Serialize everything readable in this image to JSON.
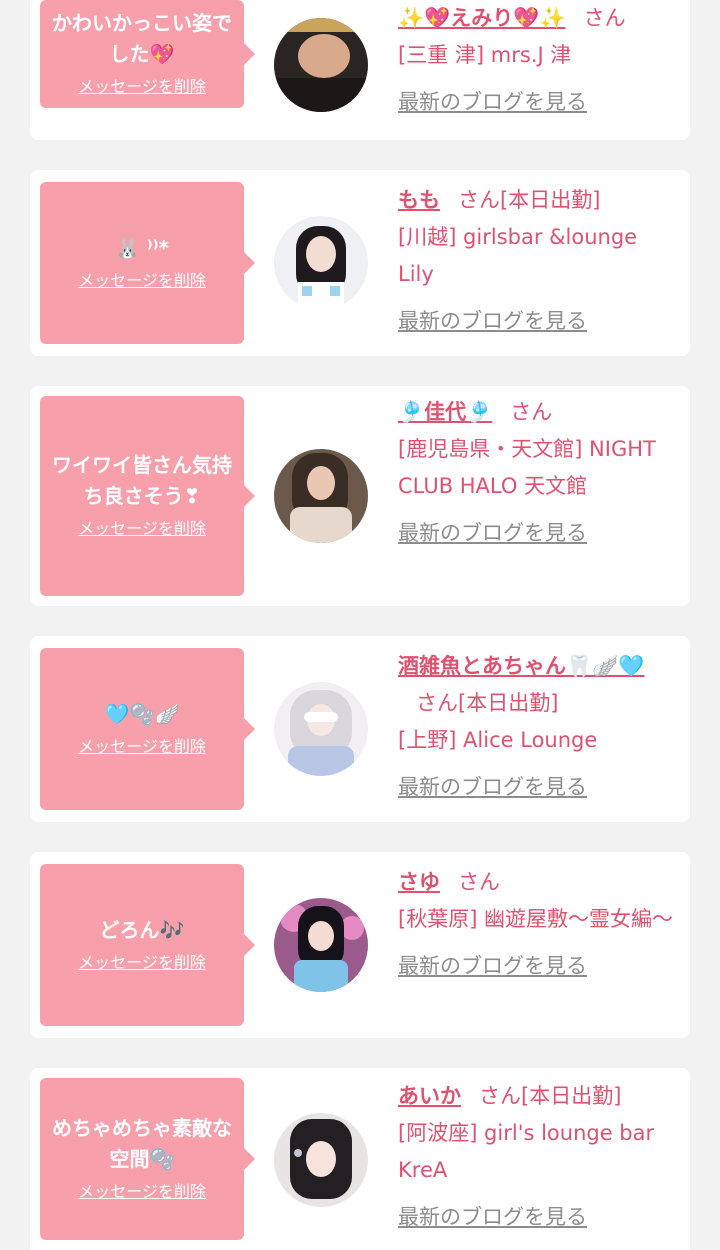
{
  "entries": [
    {
      "message": "かわいかっこい姿でした💖",
      "delete_label": "メッセージを削除",
      "name": "✨💖えみり💖✨",
      "san": "さん",
      "status": "",
      "shop": "[三重 津] mrs.J 津",
      "blog_label": "最新のブログを見る",
      "avatar_icon": "photo-avatar"
    },
    {
      "message": "🐰 ⁾⁾*",
      "delete_label": "メッセージを削除",
      "name": "もも",
      "san": "さん",
      "status": "[本日出勤]",
      "shop": "[川越] girlsbar &lounge Lily",
      "blog_label": "最新のブログを見る",
      "avatar_icon": "photo-avatar"
    },
    {
      "message": "ワイワイ皆さん気持ち良さそう❣",
      "delete_label": "メッセージを削除",
      "name": "🎐佳代🎐",
      "san": "さん",
      "status": "",
      "shop": "[鹿児島県・天文館] NIGHT CLUB HALO 天文館",
      "blog_label": "最新のブログを見る",
      "avatar_icon": "photo-avatar"
    },
    {
      "message": "🩵🫧🪽",
      "delete_label": "メッセージを削除",
      "name": "酒雑魚とあちゃん🦷🪽🩵",
      "san": "さん",
      "status": "[本日出勤]",
      "shop": "[上野] Alice Lounge",
      "blog_label": "最新のブログを見る",
      "avatar_icon": "photo-avatar"
    },
    {
      "message": "どろん🎶",
      "delete_label": "メッセージを削除",
      "name": "さゆ",
      "san": "さん",
      "status": "",
      "shop": "[秋葉原] 幽遊屋敷〜霊女編〜",
      "blog_label": "最新のブログを見る",
      "avatar_icon": "photo-avatar"
    },
    {
      "message": "めちゃめちゃ素敵な空間🫧",
      "delete_label": "メッセージを削除",
      "name": "あいか",
      "san": "さん",
      "status": "[本日出勤]",
      "shop": "[阿波座] girl's lounge bar KreA",
      "blog_label": "最新のブログを見る",
      "avatar_icon": "photo-avatar"
    }
  ],
  "colors": {
    "accent": "#e0516f",
    "bubble": "#f7a0ac",
    "link_gray": "#8d8d8d",
    "background": "#f2f2f2"
  }
}
